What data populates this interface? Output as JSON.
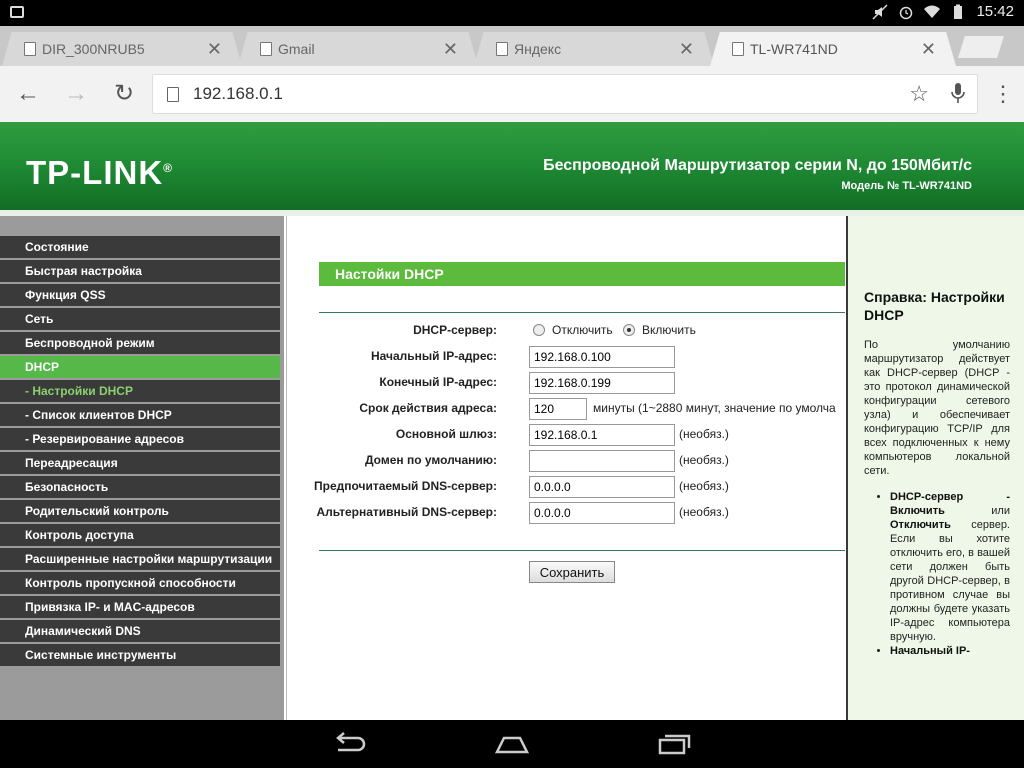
{
  "status_bar": {
    "time": "15:42"
  },
  "tabs": [
    {
      "title": "DIR_300NRUB5",
      "active": false
    },
    {
      "title": "Gmail",
      "active": false
    },
    {
      "title": "Яндекс",
      "active": false
    },
    {
      "title": "TL-WR741ND",
      "active": true
    }
  ],
  "address_bar": {
    "url": "192.168.0.1"
  },
  "banner": {
    "logo": "TP-LINK",
    "title": "Беспроводной Маршрутизатор серии N, до 150Мбит/с",
    "model": "Модель № TL-WR741ND"
  },
  "sidebar": {
    "items": [
      {
        "label": "Состояние"
      },
      {
        "label": "Быстрая настройка"
      },
      {
        "label": "Функция QSS"
      },
      {
        "label": "Сеть"
      },
      {
        "label": "Беспроводной режим"
      },
      {
        "label": "DHCP"
      },
      {
        "label": "- Настройки DHCP"
      },
      {
        "label": "- Список клиентов DHCP"
      },
      {
        "label": "- Резервирование адресов"
      },
      {
        "label": "Переадресация"
      },
      {
        "label": "Безопасность"
      },
      {
        "label": "Родительский контроль"
      },
      {
        "label": "Контроль доступа"
      },
      {
        "label": "Расширенные настройки маршрутизации"
      },
      {
        "label": "Контроль пропускной способности"
      },
      {
        "label": "Привязка IP- и MAC-адресов"
      },
      {
        "label": "Динамический DNS"
      },
      {
        "label": "Системные инструменты"
      }
    ]
  },
  "form": {
    "title": "Настойки DHCP",
    "dhcp_server_label": "DHCP-сервер:",
    "disable_label": "Отключить",
    "enable_label": "Включить",
    "start_ip_label": "Начальный IP-адрес:",
    "start_ip": "192.168.0.100",
    "end_ip_label": "Конечный IP-адрес:",
    "end_ip": "192.168.0.199",
    "lease_label": "Срок действия адреса:",
    "lease": "120",
    "lease_hint": "минуты (1~2880 минут, значение по умолча",
    "gateway_label": "Основной шлюз:",
    "gateway": "192.168.0.1",
    "optional": "(необяз.)",
    "domain_label": "Домен по умолчанию:",
    "domain": "",
    "dns1_label": "Предпочитаемый DNS-сервер:",
    "dns1": "0.0.0.0",
    "dns2_label": "Альтернативный DNS-сервер:",
    "dns2": "0.0.0.0",
    "save_label": "Сохранить"
  },
  "help": {
    "title": "Справка: Настройки DHCP",
    "intro": "По умолчанию маршрутизатор действует как DHCP-сервер (DHCP - это протокол динамической конфигурации сетевого узла) и обеспечивает конфигурацию TCP/IP для всех подключенных к нему компьютеров локальной сети.",
    "bullet1_bold1": "DHCP-сервер - Включить",
    "bullet1_mid": " или ",
    "bullet1_bold2": "Отключить",
    "bullet1_text": " сервер. Если вы хотите отключить его, в вашей сети должен быть другой DHCP-сервер, в противном случае вы должны будете указать IP-адрес компьютера вручную.",
    "bullet2": "Начальный IP-"
  }
}
